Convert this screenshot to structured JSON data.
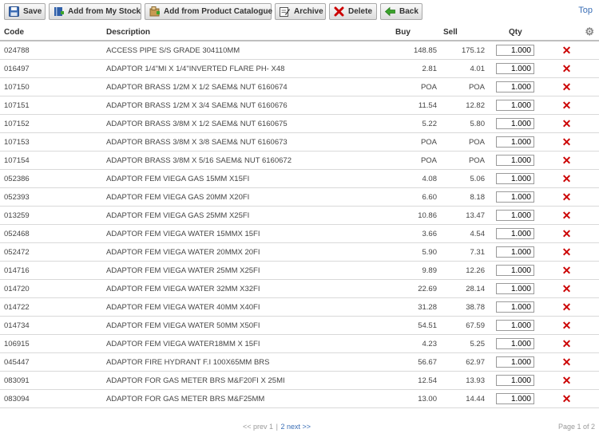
{
  "toolbar": {
    "save": "Save",
    "add_my_stock": "Add from My Stock",
    "add_catalogue": "Add from Product Catalogue",
    "archive": "Archive",
    "delete": "Delete",
    "back": "Back",
    "top_link": "Top"
  },
  "table": {
    "headers": {
      "code": "Code",
      "description": "Description",
      "buy": "Buy",
      "sell": "Sell",
      "qty": "Qty"
    },
    "rows": [
      {
        "code": "024788",
        "description": "ACCESS PIPE S/S GRADE 304110MM",
        "buy": "148.85",
        "sell": "175.12",
        "qty": "1.000"
      },
      {
        "code": "016497",
        "description": "ADAPTOR 1/4\"MI X 1/4\"INVERTED FLARE PH- X48",
        "buy": "2.81",
        "sell": "4.01",
        "qty": "1.000"
      },
      {
        "code": "107150",
        "description": "ADAPTOR BRASS 1/2M X 1/2 SAEM& NUT 6160674",
        "buy": "POA",
        "sell": "POA",
        "qty": "1.000"
      },
      {
        "code": "107151",
        "description": "ADAPTOR BRASS 1/2M X 3/4 SAEM& NUT 6160676",
        "buy": "11.54",
        "sell": "12.82",
        "qty": "1.000"
      },
      {
        "code": "107152",
        "description": "ADAPTOR BRASS 3/8M X 1/2 SAEM& NUT 6160675",
        "buy": "5.22",
        "sell": "5.80",
        "qty": "1.000"
      },
      {
        "code": "107153",
        "description": "ADAPTOR BRASS 3/8M X 3/8 SAEM& NUT 6160673",
        "buy": "POA",
        "sell": "POA",
        "qty": "1.000"
      },
      {
        "code": "107154",
        "description": "ADAPTOR BRASS 3/8M X 5/16 SAEM& NUT 6160672",
        "buy": "POA",
        "sell": "POA",
        "qty": "1.000"
      },
      {
        "code": "052386",
        "description": "ADAPTOR FEM VIEGA GAS 15MM X15FI",
        "buy": "4.08",
        "sell": "5.06",
        "qty": "1.000"
      },
      {
        "code": "052393",
        "description": "ADAPTOR FEM VIEGA GAS 20MM X20FI",
        "buy": "6.60",
        "sell": "8.18",
        "qty": "1.000"
      },
      {
        "code": "013259",
        "description": "ADAPTOR FEM VIEGA GAS 25MM X25FI",
        "buy": "10.86",
        "sell": "13.47",
        "qty": "1.000"
      },
      {
        "code": "052468",
        "description": "ADAPTOR FEM VIEGA WATER 15MMX 15FI",
        "buy": "3.66",
        "sell": "4.54",
        "qty": "1.000"
      },
      {
        "code": "052472",
        "description": "ADAPTOR FEM VIEGA WATER 20MMX 20FI",
        "buy": "5.90",
        "sell": "7.31",
        "qty": "1.000"
      },
      {
        "code": "014716",
        "description": "ADAPTOR FEM VIEGA WATER 25MM X25FI",
        "buy": "9.89",
        "sell": "12.26",
        "qty": "1.000"
      },
      {
        "code": "014720",
        "description": "ADAPTOR FEM VIEGA WATER 32MM X32FI",
        "buy": "22.69",
        "sell": "28.14",
        "qty": "1.000"
      },
      {
        "code": "014722",
        "description": "ADAPTOR FEM VIEGA WATER 40MM X40FI",
        "buy": "31.28",
        "sell": "38.78",
        "qty": "1.000"
      },
      {
        "code": "014734",
        "description": "ADAPTOR FEM VIEGA WATER 50MM X50FI",
        "buy": "54.51",
        "sell": "67.59",
        "qty": "1.000"
      },
      {
        "code": "106915",
        "description": "ADAPTOR FEM VIEGA WATER18MM X 15FI",
        "buy": "4.23",
        "sell": "5.25",
        "qty": "1.000"
      },
      {
        "code": "045447",
        "description": "ADAPTOR FIRE HYDRANT F.I 100X65MM BRS",
        "buy": "56.67",
        "sell": "62.97",
        "qty": "1.000"
      },
      {
        "code": "083091",
        "description": "ADAPTOR FOR GAS METER BRS M&F20FI X 25MI",
        "buy": "12.54",
        "sell": "13.93",
        "qty": "1.000"
      },
      {
        "code": "083094",
        "description": "ADAPTOR FOR GAS METER BRS M&F25MM",
        "buy": "13.00",
        "sell": "14.44",
        "qty": "1.000"
      }
    ]
  },
  "pager": {
    "prev": "<< prev",
    "page1": "1",
    "page2": "2",
    "next": "next >>",
    "page_count": "Page 1 of 2"
  },
  "icons": {
    "save": "floppy-disk-icon",
    "add_my_stock": "book-icon",
    "add_catalogue": "catalogue-icon",
    "archive": "archive-edit-icon",
    "delete": "red-x-icon",
    "back": "green-arrow-left-icon",
    "settings": "gear-icon",
    "row_delete": "red-x-icon"
  },
  "colors": {
    "delete_red": "#cc0000",
    "link_blue": "#3b6fb6",
    "back_green": "#3aa32a"
  }
}
